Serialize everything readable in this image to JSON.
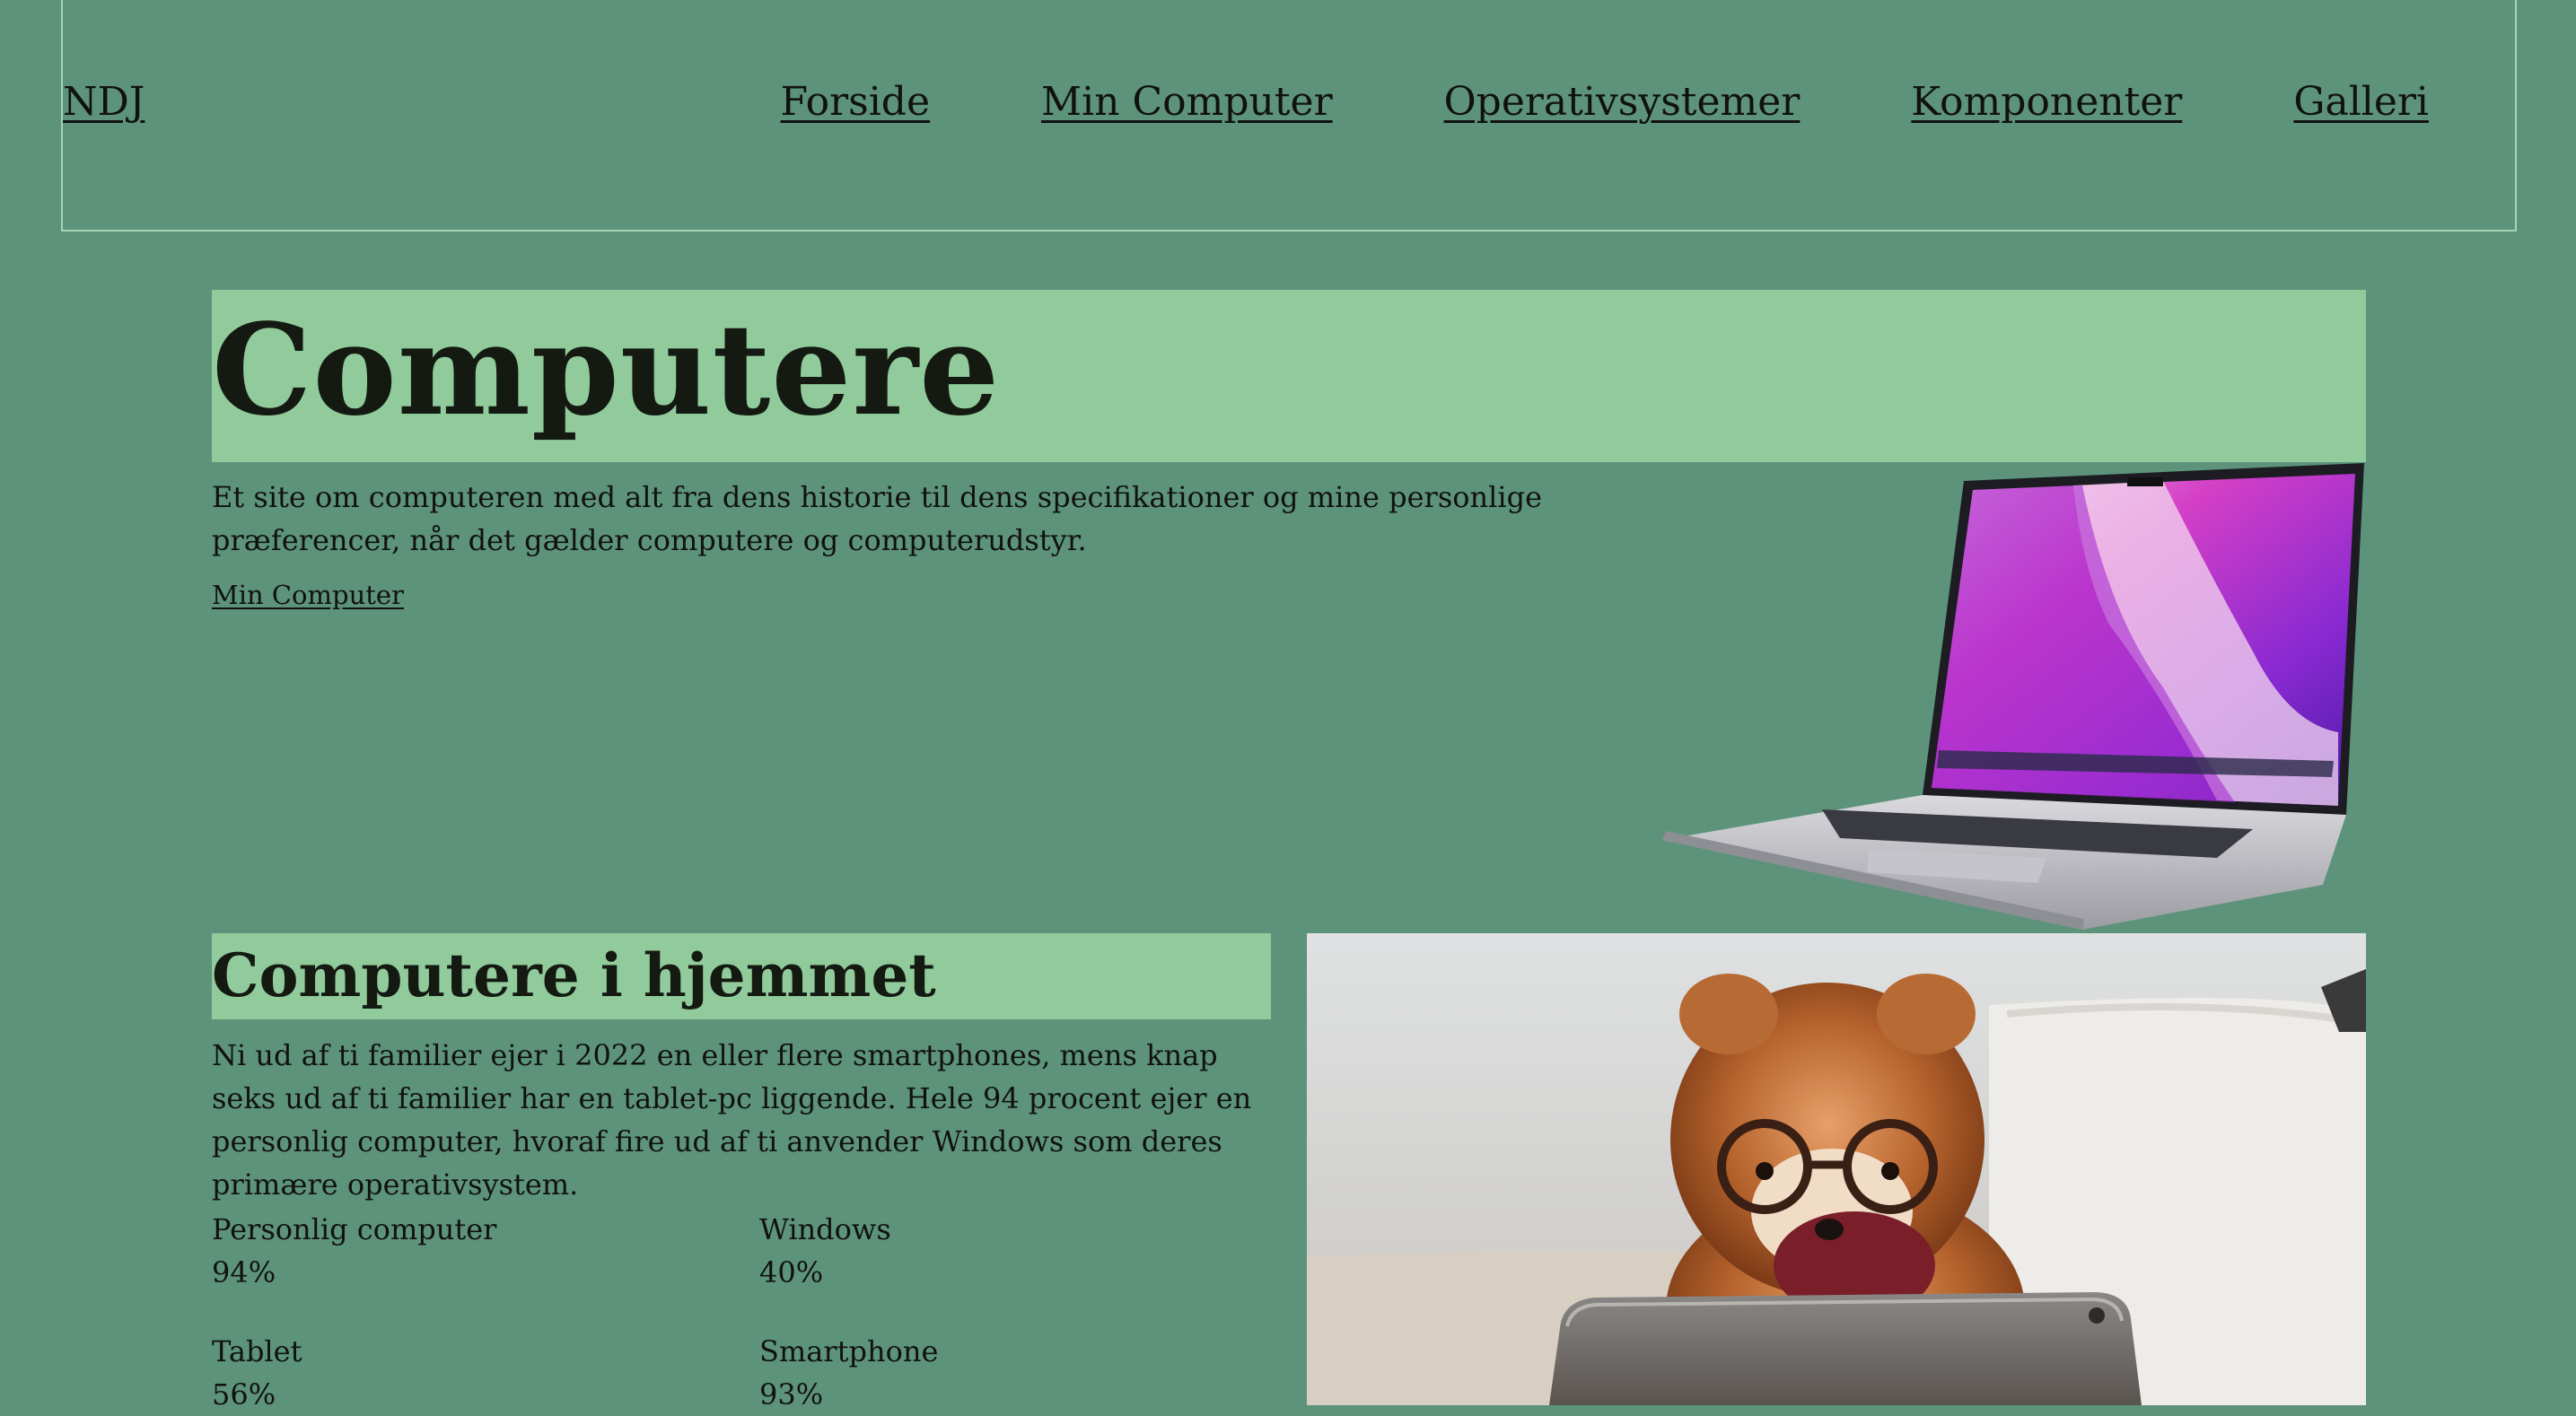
{
  "header": {
    "logo": "NDJ",
    "nav": [
      "Forside",
      "Min Computer",
      "Operativsystemer",
      "Komponenter",
      "Galleri"
    ]
  },
  "hero": {
    "title": "Computere",
    "text": "Et site om computeren med alt fra dens historie til dens specifikationer og mine personlige præferencer, når det gælder computere og computerudstyr.",
    "link": "Min Computer"
  },
  "section": {
    "title": "Computere i hjemmet",
    "text": "Ni ud af ti familier ejer i 2022 en eller flere smartphones, mens knap seks ud af ti familier har en tablet-pc liggende. Hele 94 procent ejer en personlig computer, hvoraf fire ud af ti anvender Windows som deres primære operativsystem.",
    "stats": [
      {
        "label": "Personlig computer",
        "value": "94%"
      },
      {
        "label": "Windows",
        "value": "40%"
      },
      {
        "label": "Tablet",
        "value": "56%"
      },
      {
        "label": "Smartphone",
        "value": "93%"
      }
    ]
  },
  "colors": {
    "background": "#5c937a",
    "title_bar": "#91cb9b",
    "header_border": "#a7d3b4"
  }
}
